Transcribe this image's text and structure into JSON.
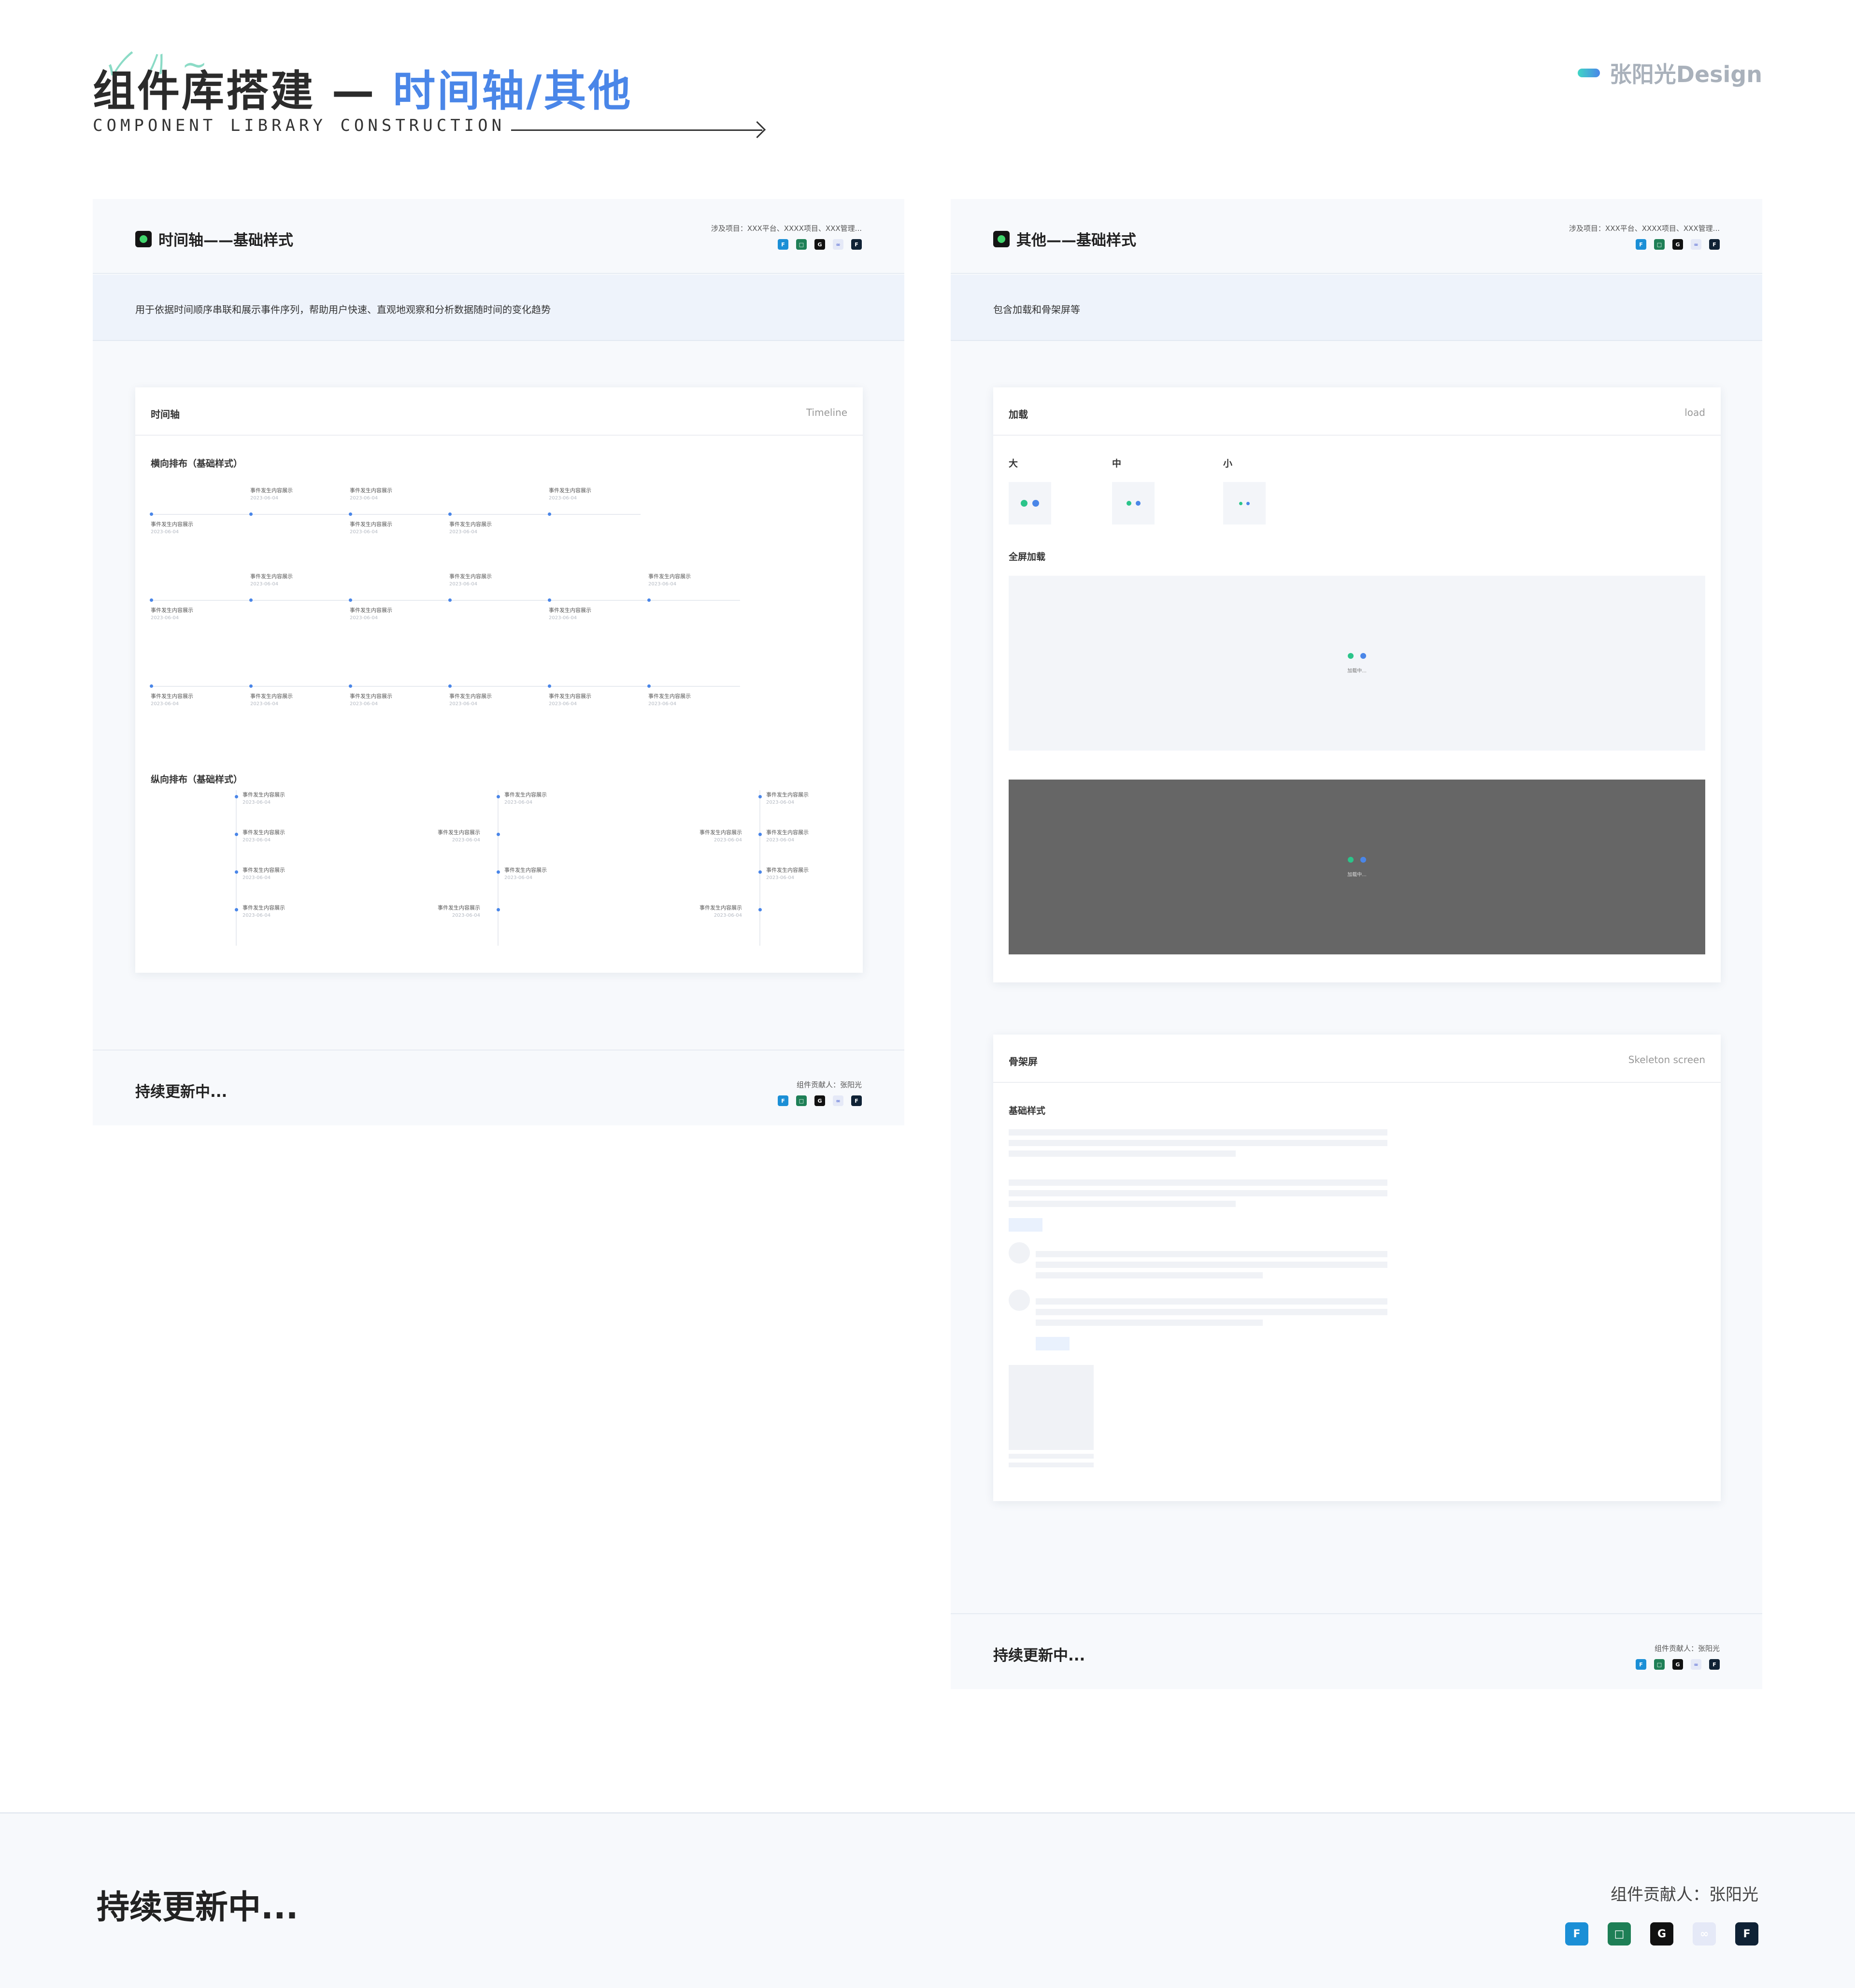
{
  "header": {
    "title_main": "组件库搭建 —",
    "title_highlight": "时间轴/其他",
    "subtitle": "COMPONENT LIBRARY CONSTRUCTION",
    "brand": "张阳光Design"
  },
  "timeline_panel": {
    "title": "时间轴——基础样式",
    "projects": "涉及项目：XXX平台、XXXX项目、XXX管理...",
    "description": "用于依据时间顺序串联和展示事件序列，帮助用户快速、直观地观察和分析数据随时间的变化趋势",
    "card_title": "时间轴",
    "card_title_en": "Timeline",
    "horizontal_label": "横向排布（基础样式）",
    "vertical_label": "纵向排布（基础样式）",
    "event_text": "事件发生内容展示",
    "event_date": "2023-06-04",
    "footer_text": "持续更新中...",
    "contributor": "组件贡献人：张阳光"
  },
  "other_panel": {
    "title": "其他——基础样式",
    "projects": "涉及项目：XXX平台、XXXX项目、XXX管理...",
    "description": "包含加载和骨架屏等",
    "load_card_title": "加载",
    "load_card_title_en": "load",
    "size_large": "大",
    "size_medium": "中",
    "size_small": "小",
    "fullscreen_label": "全屏加载",
    "loading_text": "加载中...",
    "skeleton_card_title": "骨架屏",
    "skeleton_card_title_en": "Skeleton screen",
    "skeleton_label": "基础样式",
    "footer_text": "持续更新中...",
    "contributor": "组件贡献人：张阳光"
  },
  "page_footer": {
    "text": "持续更新中...",
    "contributor": "组件贡献人：张阳光"
  },
  "tools": [
    {
      "name": "figma-icon",
      "glyph": "F"
    },
    {
      "name": "sketch-icon",
      "glyph": "□"
    },
    {
      "name": "pixso-icon",
      "glyph": "G"
    },
    {
      "name": "mastergo-icon",
      "glyph": "∞"
    },
    {
      "name": "framer-icon",
      "glyph": "F"
    }
  ],
  "colors": {
    "accent_blue": "#4a86e8",
    "accent_green": "#2bc48a",
    "overlay_gray": "#666666"
  }
}
